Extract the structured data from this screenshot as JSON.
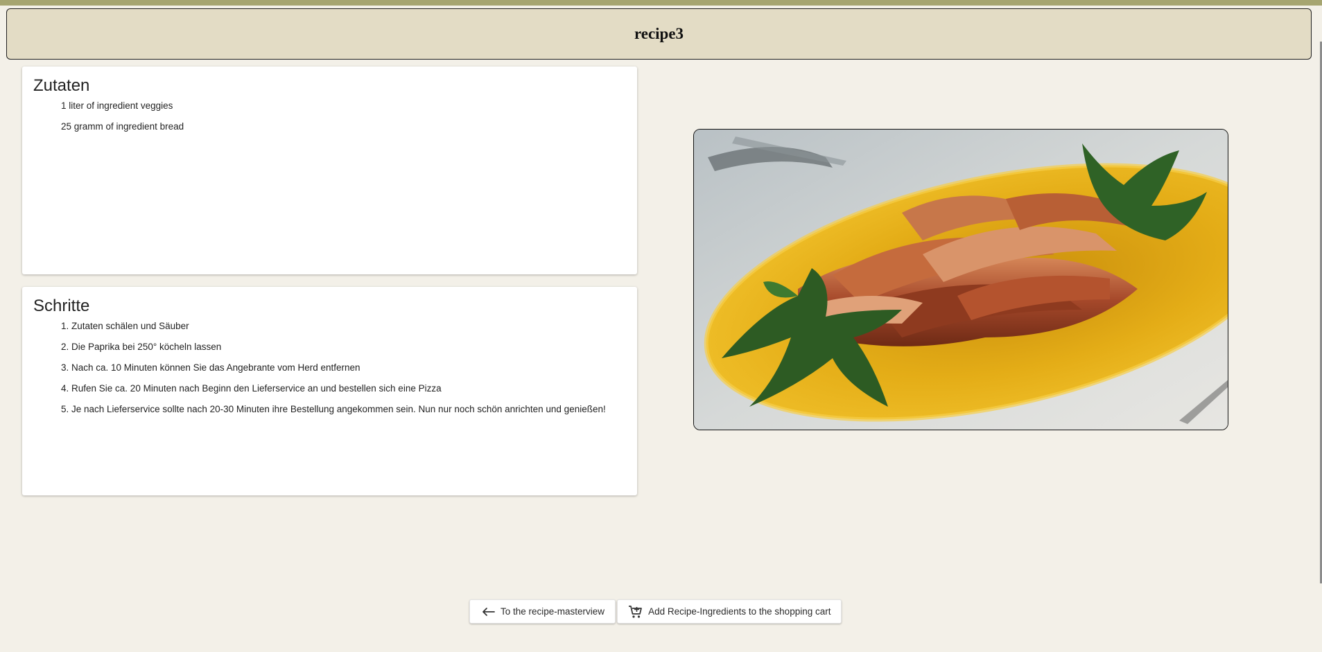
{
  "header": {
    "title": "recipe3"
  },
  "ingredients": {
    "title": "Zutaten",
    "items": [
      "1 liter of ingredient veggies",
      "25 gramm of ingredient bread"
    ]
  },
  "steps": {
    "title": "Schritte",
    "items": [
      "1. Zutaten schälen und Säuber",
      "2. Die Paprika bei 250° köcheln lassen",
      "3. Nach ca. 10 Minuten können Sie das Angebrante vom Herd entfernen",
      "4. Rufen Sie ca. 20 Minuten nach Beginn den Lieferservice an und bestellen sich eine Pizza",
      "5. Je nach Lieferservice sollte nach 20-30 Minuten ihre Bestellung angekommen sein. Nun nur noch schön anrichten und genießen!"
    ]
  },
  "image": {
    "subject": "bacon-wrapped chicken on a yellow plate with parsley",
    "icon": "dish-photo"
  },
  "actions": {
    "back_label": "To the recipe-masterview",
    "back_icon": "arrow-left-icon",
    "cart_label": "Add Recipe-Ingredients to the shopping cart",
    "cart_icon": "cart-plus-icon"
  },
  "colors": {
    "page_background": "#f3f0e8",
    "header_background": "#e3dcc5",
    "top_stripe": "#a6a571",
    "card_background": "#ffffff",
    "plate_yellow": "#e1ab14"
  }
}
